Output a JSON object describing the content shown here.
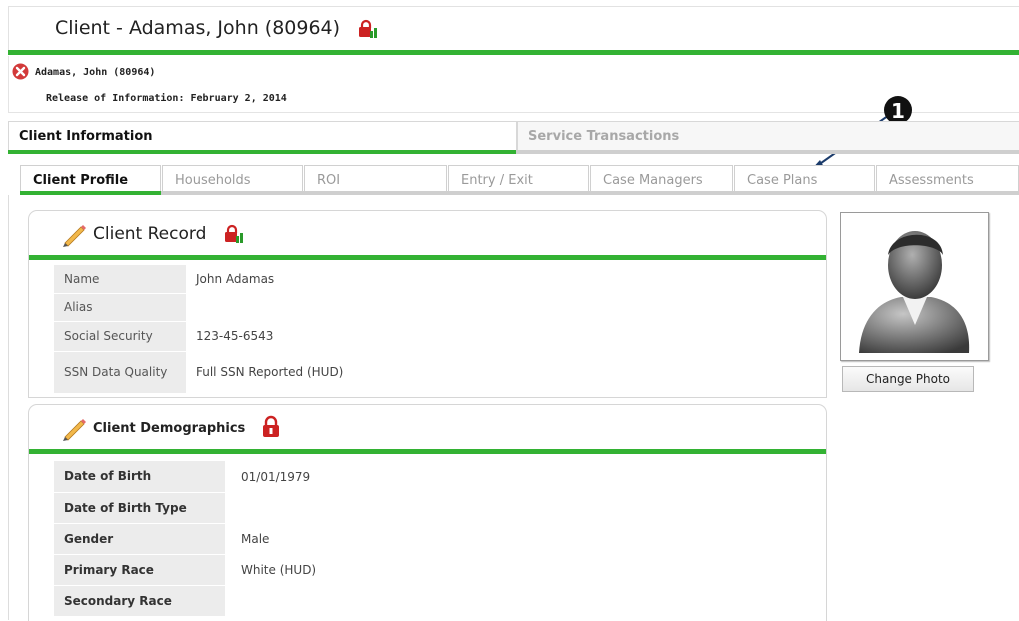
{
  "header": {
    "title": "Client - Adamas, John (80964)"
  },
  "client_info": {
    "name": "Adamas, John (80964)",
    "release": "Release of Information: February 2, 2014"
  },
  "top_tabs": [
    {
      "label": "Client Information",
      "active": true
    },
    {
      "label": "Service Transactions",
      "active": false
    }
  ],
  "sub_tabs": [
    {
      "label": "Client Profile",
      "active": true
    },
    {
      "label": "Households",
      "active": false
    },
    {
      "label": "ROI",
      "active": false
    },
    {
      "label": "Entry / Exit",
      "active": false
    },
    {
      "label": "Case Managers",
      "active": false
    },
    {
      "label": "Case Plans",
      "active": false
    },
    {
      "label": "Assessments",
      "active": false
    }
  ],
  "callout": {
    "number": "1"
  },
  "client_record": {
    "title": "Client Record",
    "rows": [
      {
        "label": "Name",
        "value": "John Adamas"
      },
      {
        "label": "Alias",
        "value": ""
      },
      {
        "label": "Social Security",
        "value": "123-45-6543"
      },
      {
        "label": "SSN Data Quality",
        "value": "Full SSN Reported (HUD)"
      }
    ]
  },
  "demographics": {
    "title": "Client Demographics",
    "rows": [
      {
        "label": "Date of Birth",
        "value": "01/01/1979"
      },
      {
        "label": "Date of Birth Type",
        "value": ""
      },
      {
        "label": "Gender",
        "value": "Male"
      },
      {
        "label": "Primary Race",
        "value": "White (HUD)"
      },
      {
        "label": "Secondary Race",
        "value": ""
      }
    ]
  },
  "photo": {
    "change_label": "Change Photo"
  },
  "colors": {
    "accent_green": "#33b233",
    "lock_red": "#cc2222",
    "tab_gray": "#cfcfcf"
  },
  "icons": {
    "error": "error-icon",
    "lock": "lock-icon",
    "pencil": "pencil-icon",
    "person": "person-silhouette-icon"
  }
}
